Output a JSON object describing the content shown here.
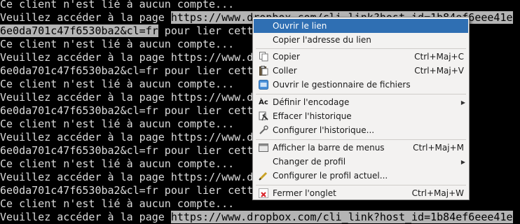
{
  "terminal": {
    "lines": [
      {
        "plain": "Ce client n'est lié à aucun compte..."
      },
      {
        "pre": "Veuillez accéder à la page ",
        "hl": "https://www.dropbox.com/cli_link?host_id=1b84ef6eee41e"
      },
      {
        "hl": "6e0da701c47f6530ba2&cl=fr",
        "post": " pour lier cett"
      },
      {
        "plain": "Ce client n'est lié à aucun compte..."
      },
      {
        "plain": "Veuillez accéder à la page https://www.d                            eee41e"
      },
      {
        "plain": "6e0da701c47f6530ba2&cl=fr pour lier cett"
      },
      {
        "plain": "Ce client n'est lié à aucun compte..."
      },
      {
        "plain": "Veuillez accéder à la page https://www.d                            eee41e"
      },
      {
        "plain": "6e0da701c47f6530ba2&cl=fr pour lier cett"
      },
      {
        "plain": "Ce client n'est lié à aucun compte..."
      },
      {
        "plain": "Veuillez accéder à la page https://www.d                            eee41e"
      },
      {
        "plain": "6e0da701c47f6530ba2&cl=fr pour lier cett"
      },
      {
        "plain": "Ce client n'est lié à aucun compte..."
      },
      {
        "plain": "Veuillez accéder à la page https://www.d                            eee41e"
      },
      {
        "plain": "6e0da701c47f6530ba2&cl=fr pour lier cett"
      },
      {
        "plain": "Ce client n'est lié à aucun compte..."
      },
      {
        "pre": "Veuillez accéder à la page ",
        "hl": "https://www.dropbox.com/cli_link?host_id=1b84ef6eee41e"
      }
    ]
  },
  "context_menu": {
    "items": [
      {
        "label": "Ouvrir le lien",
        "shortcut": "",
        "icon": "",
        "hover": true
      },
      {
        "label": "Copier l'adresse du lien",
        "shortcut": "",
        "icon": ""
      },
      {
        "label": "Copier",
        "shortcut": "Ctrl+Maj+C",
        "icon": "copy-icon"
      },
      {
        "label": "Coller",
        "shortcut": "Ctrl+Maj+V",
        "icon": "paste-icon"
      },
      {
        "label": "Ouvrir le gestionnaire de fichiers",
        "shortcut": "",
        "icon": "file-manager-icon"
      },
      {
        "label": "Définir l'encodage",
        "shortcut": "",
        "icon": "encoding-icon",
        "submenu": true
      },
      {
        "label": "Effacer l'historique",
        "shortcut": "",
        "icon": "clear-history-icon"
      },
      {
        "label": "Configurer l'historique...",
        "shortcut": "",
        "icon": "configure-history-icon"
      },
      {
        "label": "Afficher la barre de menus",
        "shortcut": "Ctrl+Maj+M",
        "icon": "menubar-icon"
      },
      {
        "label": "Changer de profil",
        "shortcut": "",
        "icon": "",
        "submenu": true
      },
      {
        "label": "Configurer le profil actuel...",
        "shortcut": "",
        "icon": "configure-profile-icon"
      },
      {
        "label": "Fermer l'onglet",
        "shortcut": "Ctrl+Maj+W",
        "icon": "close-tab-icon"
      }
    ],
    "encoding_icon_text": "Àc"
  },
  "colors": {
    "highlight": "#2f6fb3",
    "terminal_bg": "#000000",
    "terminal_fg": "#dcdcdc",
    "menu_bg": "#f3f2f1"
  }
}
